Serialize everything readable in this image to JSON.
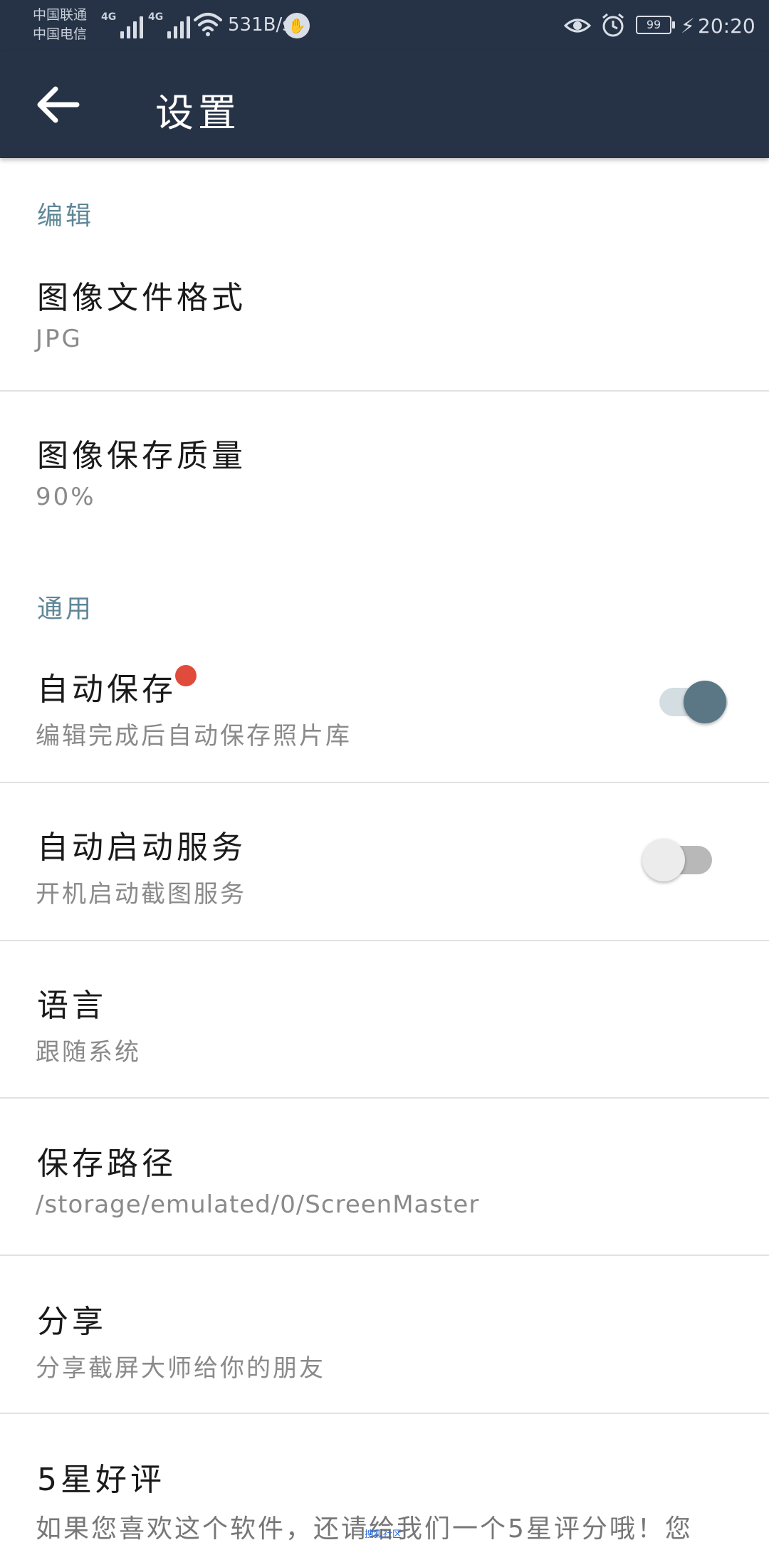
{
  "status_bar": {
    "carrier_1": "中国联通",
    "carrier_2": "中国电信",
    "network_1": "4G",
    "network_2": "4G",
    "net_speed": "531B/s",
    "battery": "99",
    "time": "20:20"
  },
  "app_bar": {
    "back_icon": "arrow-left-icon",
    "title": "设置"
  },
  "sections": [
    {
      "header": "编辑",
      "items": [
        {
          "title": "图像文件格式",
          "subtitle": "JPG"
        },
        {
          "title": "图像保存质量",
          "subtitle": "90%"
        }
      ]
    },
    {
      "header": "通用",
      "items": [
        {
          "title": "自动保存",
          "subtitle": "编辑完成后自动保存照片库",
          "toggle": true,
          "badge": "red-dot"
        },
        {
          "title": "自动启动服务",
          "subtitle": "开机启动截图服务",
          "toggle": false
        },
        {
          "title": "语言",
          "subtitle": "跟随系统"
        },
        {
          "title": "保存路径",
          "subtitle": "/storage/emulated/0/ScreenMaster"
        },
        {
          "title": "分享",
          "subtitle": "分享截屏大师给你的朋友"
        },
        {
          "title": "5星好评",
          "subtitle": "如果您喜欢这个软件，还请给我们一个5星评分哦！您"
        }
      ]
    }
  ],
  "colors": {
    "app_bar": "#263347",
    "section_header": "#5f8797",
    "toggle_on_thumb": "#5b7785",
    "toggle_on_track": "#d3dde2",
    "toggle_off_thumb": "#ececec",
    "toggle_off_track": "#b8b8b8",
    "badge": "#e14b3c"
  },
  "watermark": "搜狐社区"
}
